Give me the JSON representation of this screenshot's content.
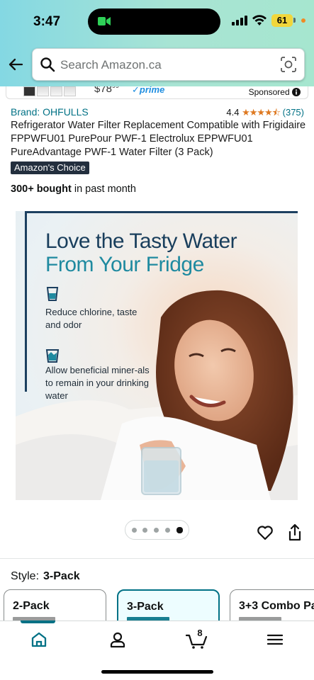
{
  "status_bar": {
    "time": "3:47",
    "battery": "61"
  },
  "search": {
    "placeholder": "Search Amazon.ca"
  },
  "ad": {
    "price_whole": "$78",
    "price_cents": "99",
    "prime": "✓prime",
    "sponsored_label": "Sponsored"
  },
  "product": {
    "brand": "Brand: OHFULLS",
    "rating_value": "4.4",
    "rating_stars": "★★★★⯪",
    "rating_count": "(375)",
    "title": "Refrigerator Water Filter Replacement Compatible with Frigidaire FPPWFU01 PurePour PWF-1 Electrolux EPPWFU01 PureAdvantage PWF-1 Water Filter (3 Pack)",
    "badge": "Amazon's Choice",
    "bought_bold": "300+ bought",
    "bought_rest": " in past month"
  },
  "hero_image": {
    "headline_1": "Love the Tasty Water",
    "headline_2": "From Your Fridge",
    "feature_1": "Reduce chlorine, taste and odor",
    "feature_2": "Allow beneficial miner-als to remain in your drinking water"
  },
  "carousel": {
    "count": 5,
    "active_index": 4
  },
  "style": {
    "label": "Style:",
    "selected": "3-Pack",
    "options": [
      {
        "label": "2-Pack",
        "selected": false
      },
      {
        "label": "3-Pack",
        "selected": true
      },
      {
        "label": "3+3 Combo Pa",
        "selected": false
      }
    ]
  },
  "tabbar": {
    "cart_count": "8",
    "active_tab": "home"
  },
  "colors": {
    "accent": "#007185",
    "header_start": "#84d8e3",
    "header_end": "#a6e6cf",
    "star": "#de7921",
    "badge_bg": "#232f3e"
  }
}
